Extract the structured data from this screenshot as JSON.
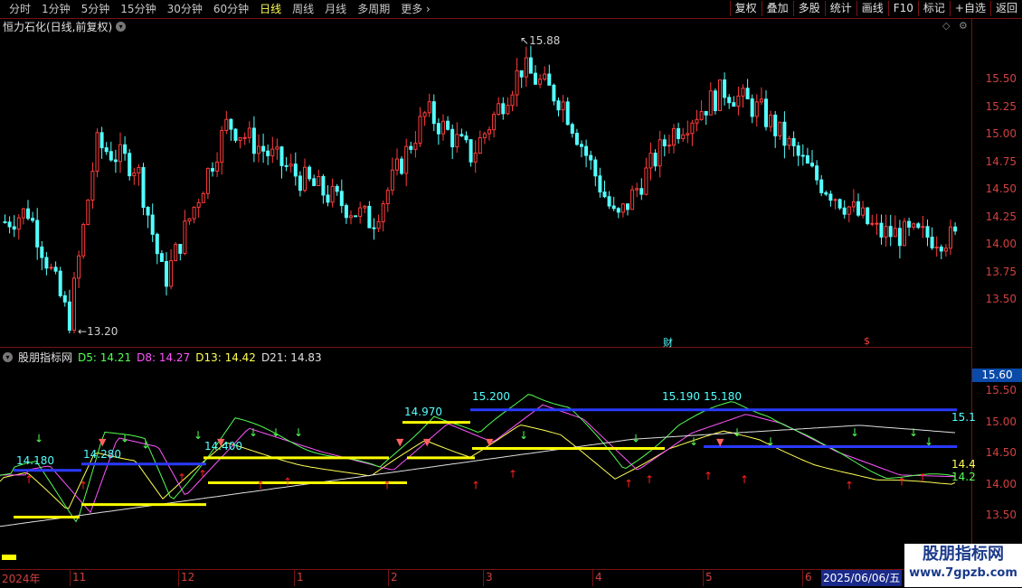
{
  "toolbar": {
    "periods": [
      "分时",
      "1分钟",
      "5分钟",
      "15分钟",
      "30分钟",
      "60分钟",
      "日线",
      "周线",
      "月线",
      "多周期",
      "更多"
    ],
    "active_period": "日线",
    "buttons": [
      "复权",
      "叠加",
      "多股",
      "统计",
      "画线",
      "F10",
      "标记",
      "+自选",
      "返回"
    ]
  },
  "main": {
    "title": "恒力石化(日线,前复权)",
    "price_ticks": [
      "15.50",
      "15.25",
      "15.00",
      "14.75",
      "14.50",
      "14.25",
      "14.00",
      "13.75",
      "13.50"
    ],
    "high_label": "15.88",
    "low_label": "13.20",
    "markers": [
      "财",
      "$"
    ]
  },
  "indicator": {
    "name": "股朋指标网",
    "d5_label": "D5: 14.21",
    "d8_label": "D8: 14.27",
    "d13_label": "D13: 14.42",
    "d21_label": "D21: 14.83",
    "current_value": "15.60",
    "ticks": [
      "15.50",
      "15.00",
      "14.50",
      "14.00",
      "13.50"
    ],
    "level_labels": [
      "14.180",
      "14.280",
      "14.400",
      "14.970",
      "15.200",
      "15.190",
      "15.180"
    ],
    "right_values": [
      "15.1",
      "14.4",
      "14.2"
    ]
  },
  "xaxis": {
    "labels": [
      "2024年",
      "11",
      "12",
      "1",
      "2",
      "3",
      "4",
      "5",
      "6"
    ],
    "current_date": "2025/06/06/五"
  },
  "watermark": {
    "line1": "股朋指标网",
    "line2": "www.7gpzb.com"
  },
  "colors": {
    "up": "#ff3c3c",
    "down": "#54ffff",
    "bg": "#000000",
    "grid": "#7a1010"
  }
}
